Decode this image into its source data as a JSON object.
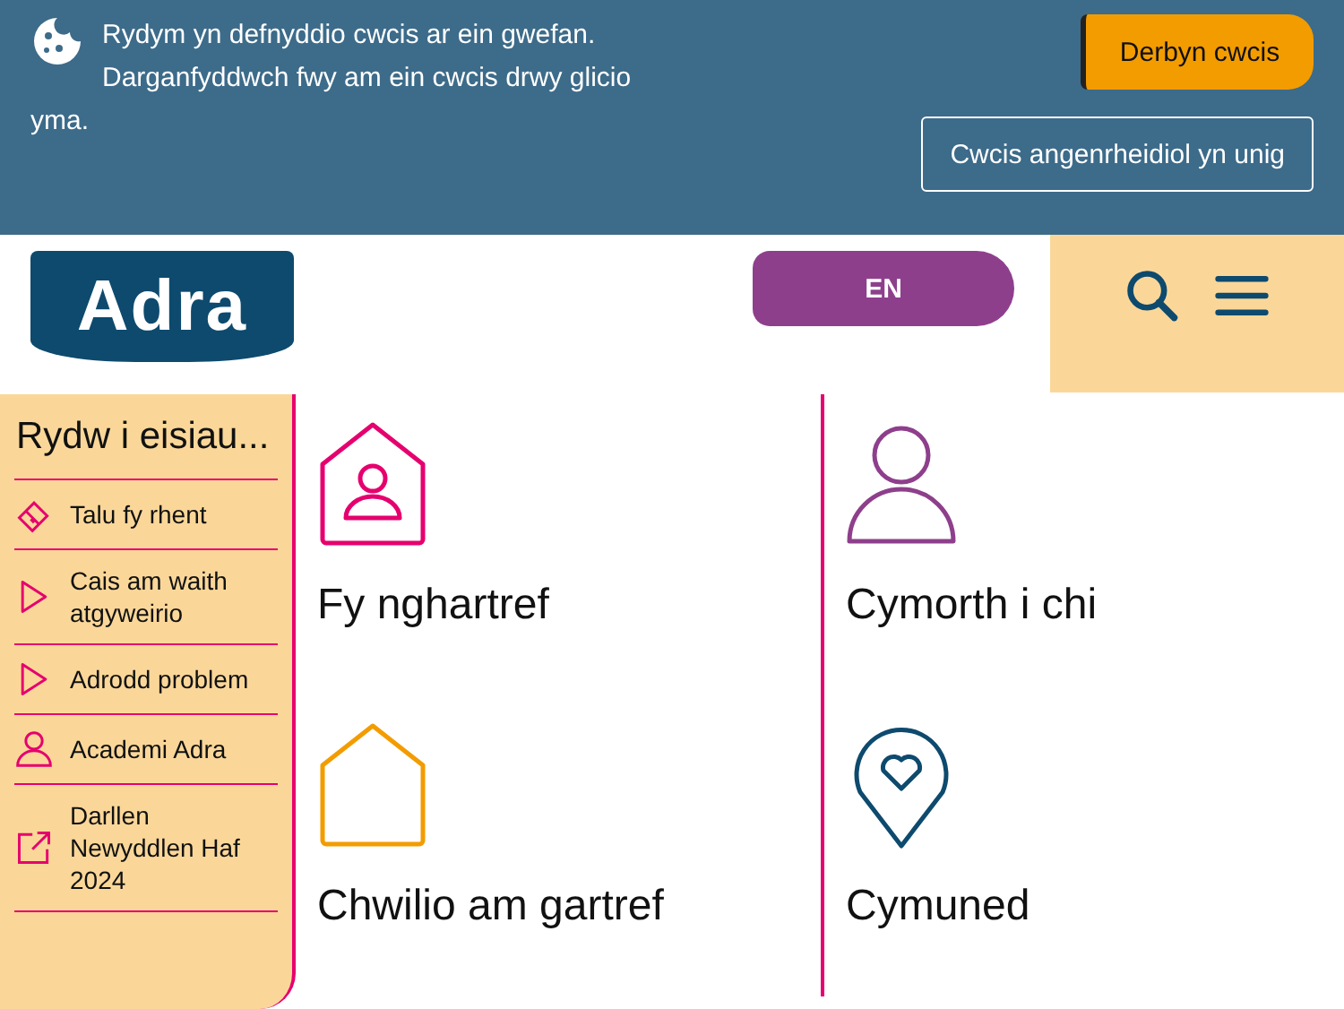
{
  "cookie_banner": {
    "message": "Rydym yn defnyddio cwcis ar ein gwefan. Darganfyddwch fwy am ein cwcis drwy glicio yma.",
    "buttons": [
      {
        "label": "Derbyn cwcis",
        "kind": "primary"
      },
      {
        "label": "Cwcis angenrheidiol yn unig",
        "kind": "outline"
      }
    ]
  },
  "header": {
    "logo": "Adra",
    "language_button": "EN"
  },
  "sidebar": {
    "title": "Rydw i eisiau...",
    "items": [
      {
        "label": "Talu fy rhent",
        "kind": "card"
      },
      {
        "label": "Cais am waith atgyweirio",
        "kind": "arrow"
      },
      {
        "label": "Adrodd problem",
        "kind": "arrow"
      },
      {
        "label": "Academi Adra",
        "kind": "person"
      },
      {
        "label": "Darllen Newyddlen Haf 2024",
        "kind": "external"
      }
    ]
  },
  "tiles": [
    {
      "label": "Fy nghartref",
      "kind": "house-person",
      "color": "#e6006e"
    },
    {
      "label": "Cymorth i chi",
      "kind": "person",
      "color": "#8e3f8c"
    },
    {
      "label": "Chwilio am gartref",
      "kind": "house",
      "color": "#f39c00"
    },
    {
      "label": "Cymuned",
      "kind": "pin-heart",
      "color": "#0d4a6e"
    }
  ]
}
